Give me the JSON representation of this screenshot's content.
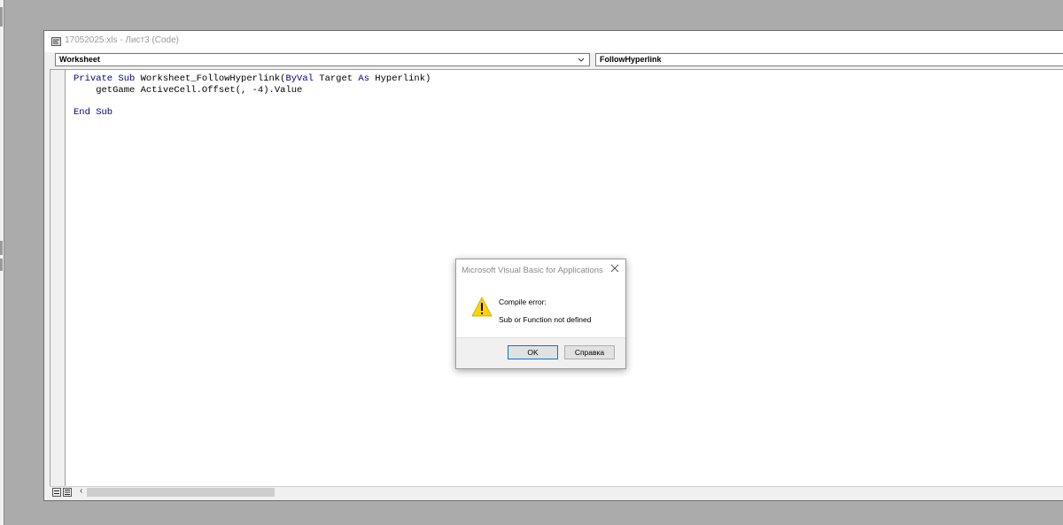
{
  "code_window": {
    "title": "17052025.xls - Лист3 (Code)",
    "object_combo": "Worksheet",
    "procedure_combo": "FollowHyperlink",
    "code_lines": [
      [
        {
          "t": "Private Sub",
          "k": true
        },
        {
          "t": " Worksheet_FollowHyperlink(",
          "k": false
        },
        {
          "t": "ByVal",
          "k": true
        },
        {
          "t": " Target ",
          "k": false
        },
        {
          "t": "As",
          "k": true
        },
        {
          "t": " Hyperlink)",
          "k": false
        }
      ],
      [
        {
          "t": "    getGame ActiveCell.Offset(, -4).Value",
          "k": false
        }
      ],
      [
        {
          "t": "",
          "k": false
        }
      ],
      [
        {
          "t": "End Sub",
          "k": true
        }
      ]
    ]
  },
  "dialog": {
    "title": "Microsoft Visual Basic for Applications",
    "error_title": "Compile error:",
    "error_message": "Sub or Function not defined",
    "ok_label": "OK",
    "help_label": "Справка"
  },
  "colors": {
    "keyword": "#00007f",
    "mdi_background": "#ababab",
    "warning_yellow": "#ffd400"
  }
}
